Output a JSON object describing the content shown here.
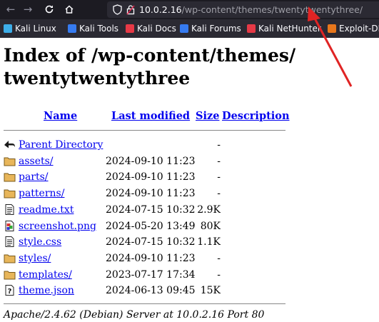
{
  "browser": {
    "url_host": "10.0.2.16",
    "url_path": "/wp-content/themes/twentytwentythree/"
  },
  "bookmarks": [
    {
      "label": "Kali Linux",
      "icon": "kali-dragon-icon",
      "color": "#3daee9"
    },
    {
      "label": "Kali Tools",
      "icon": "kali-tools-icon",
      "color": "#367bf0"
    },
    {
      "label": "Kali Docs",
      "icon": "kali-docs-icon",
      "color": "#e63946"
    },
    {
      "label": "Kali Forums",
      "icon": "kali-forums-icon",
      "color": "#367bf0"
    },
    {
      "label": "Kali NetHunter",
      "icon": "nethunter-icon",
      "color": "#e63946"
    },
    {
      "label": "Exploit-DB",
      "icon": "exploit-db-icon",
      "color": "#e8771c"
    }
  ],
  "page": {
    "title": "Index of /wp-content/themes/ twentytwentythree",
    "headers": {
      "name": "Name",
      "last_modified": "Last modified",
      "size": "Size",
      "description": "Description"
    },
    "rows": [
      {
        "name": "Parent Directory",
        "date": "",
        "size": "-",
        "icon": "back-arrow-icon"
      },
      {
        "name": "assets/",
        "date": "2024-09-10 11:23",
        "size": "-",
        "icon": "folder-icon"
      },
      {
        "name": "parts/",
        "date": "2024-09-10 11:23",
        "size": "-",
        "icon": "folder-icon"
      },
      {
        "name": "patterns/",
        "date": "2024-09-10 11:23",
        "size": "-",
        "icon": "folder-icon"
      },
      {
        "name": "readme.txt",
        "date": "2024-07-15 10:32",
        "size": "2.9K",
        "icon": "text-file-icon"
      },
      {
        "name": "screenshot.png",
        "date": "2024-05-20 13:49",
        "size": "80K",
        "icon": "image-file-icon"
      },
      {
        "name": "style.css",
        "date": "2024-07-15 10:32",
        "size": "1.1K",
        "icon": "text-file-icon"
      },
      {
        "name": "styles/",
        "date": "2024-09-10 11:23",
        "size": "-",
        "icon": "folder-icon"
      },
      {
        "name": "templates/",
        "date": "2023-07-17 17:34",
        "size": "-",
        "icon": "folder-icon"
      },
      {
        "name": "theme.json",
        "date": "2024-06-13 09:45",
        "size": "15K",
        "icon": "unknown-file-icon"
      }
    ],
    "footer": "Apache/2.4.62 (Debian) Server at 10.0.2.16 Port 80"
  },
  "annotation": {
    "color": "#e02424"
  }
}
